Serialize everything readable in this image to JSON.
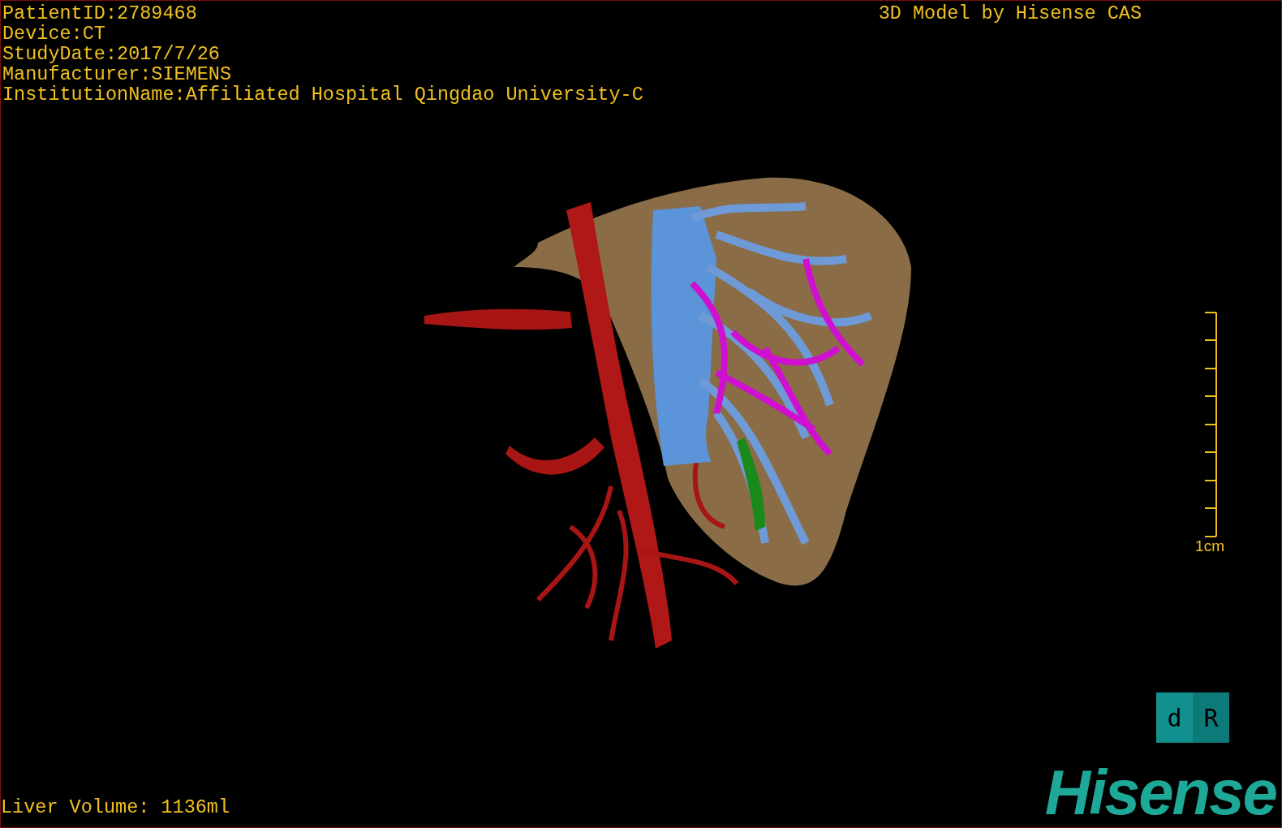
{
  "header": {
    "study_info": [
      "PatientID:2789468",
      "Device:CT",
      "StudyDate:2017/7/26",
      "Manufacturer:SIEMENS",
      "InstitutionName:Affiliated Hospital Qingdao University-C"
    ],
    "title": "3D Model by Hisense CAS"
  },
  "scale_bar": {
    "label": "1cm"
  },
  "footer": {
    "volume": "Liver Volume: 1136ml",
    "orientation_cube": [
      "d",
      "R"
    ],
    "logo": "Hisense"
  }
}
